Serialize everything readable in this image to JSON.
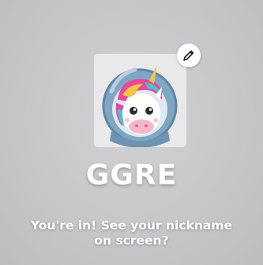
{
  "player": {
    "nickname": "GGRE",
    "avatar_icon": "unicorn-astronaut-avatar"
  },
  "edit_button": {
    "icon": "pencil-icon"
  },
  "message": {
    "line1": "You're in! See your nickname",
    "line2": "on screen?"
  },
  "colors": {
    "background": "#c7c7c9",
    "text": "#ffffff",
    "helmet": "#7fa6c2",
    "mane_pink": "#e8479a",
    "mane_yellow": "#f5c542",
    "mane_teal": "#4cc3c9"
  }
}
